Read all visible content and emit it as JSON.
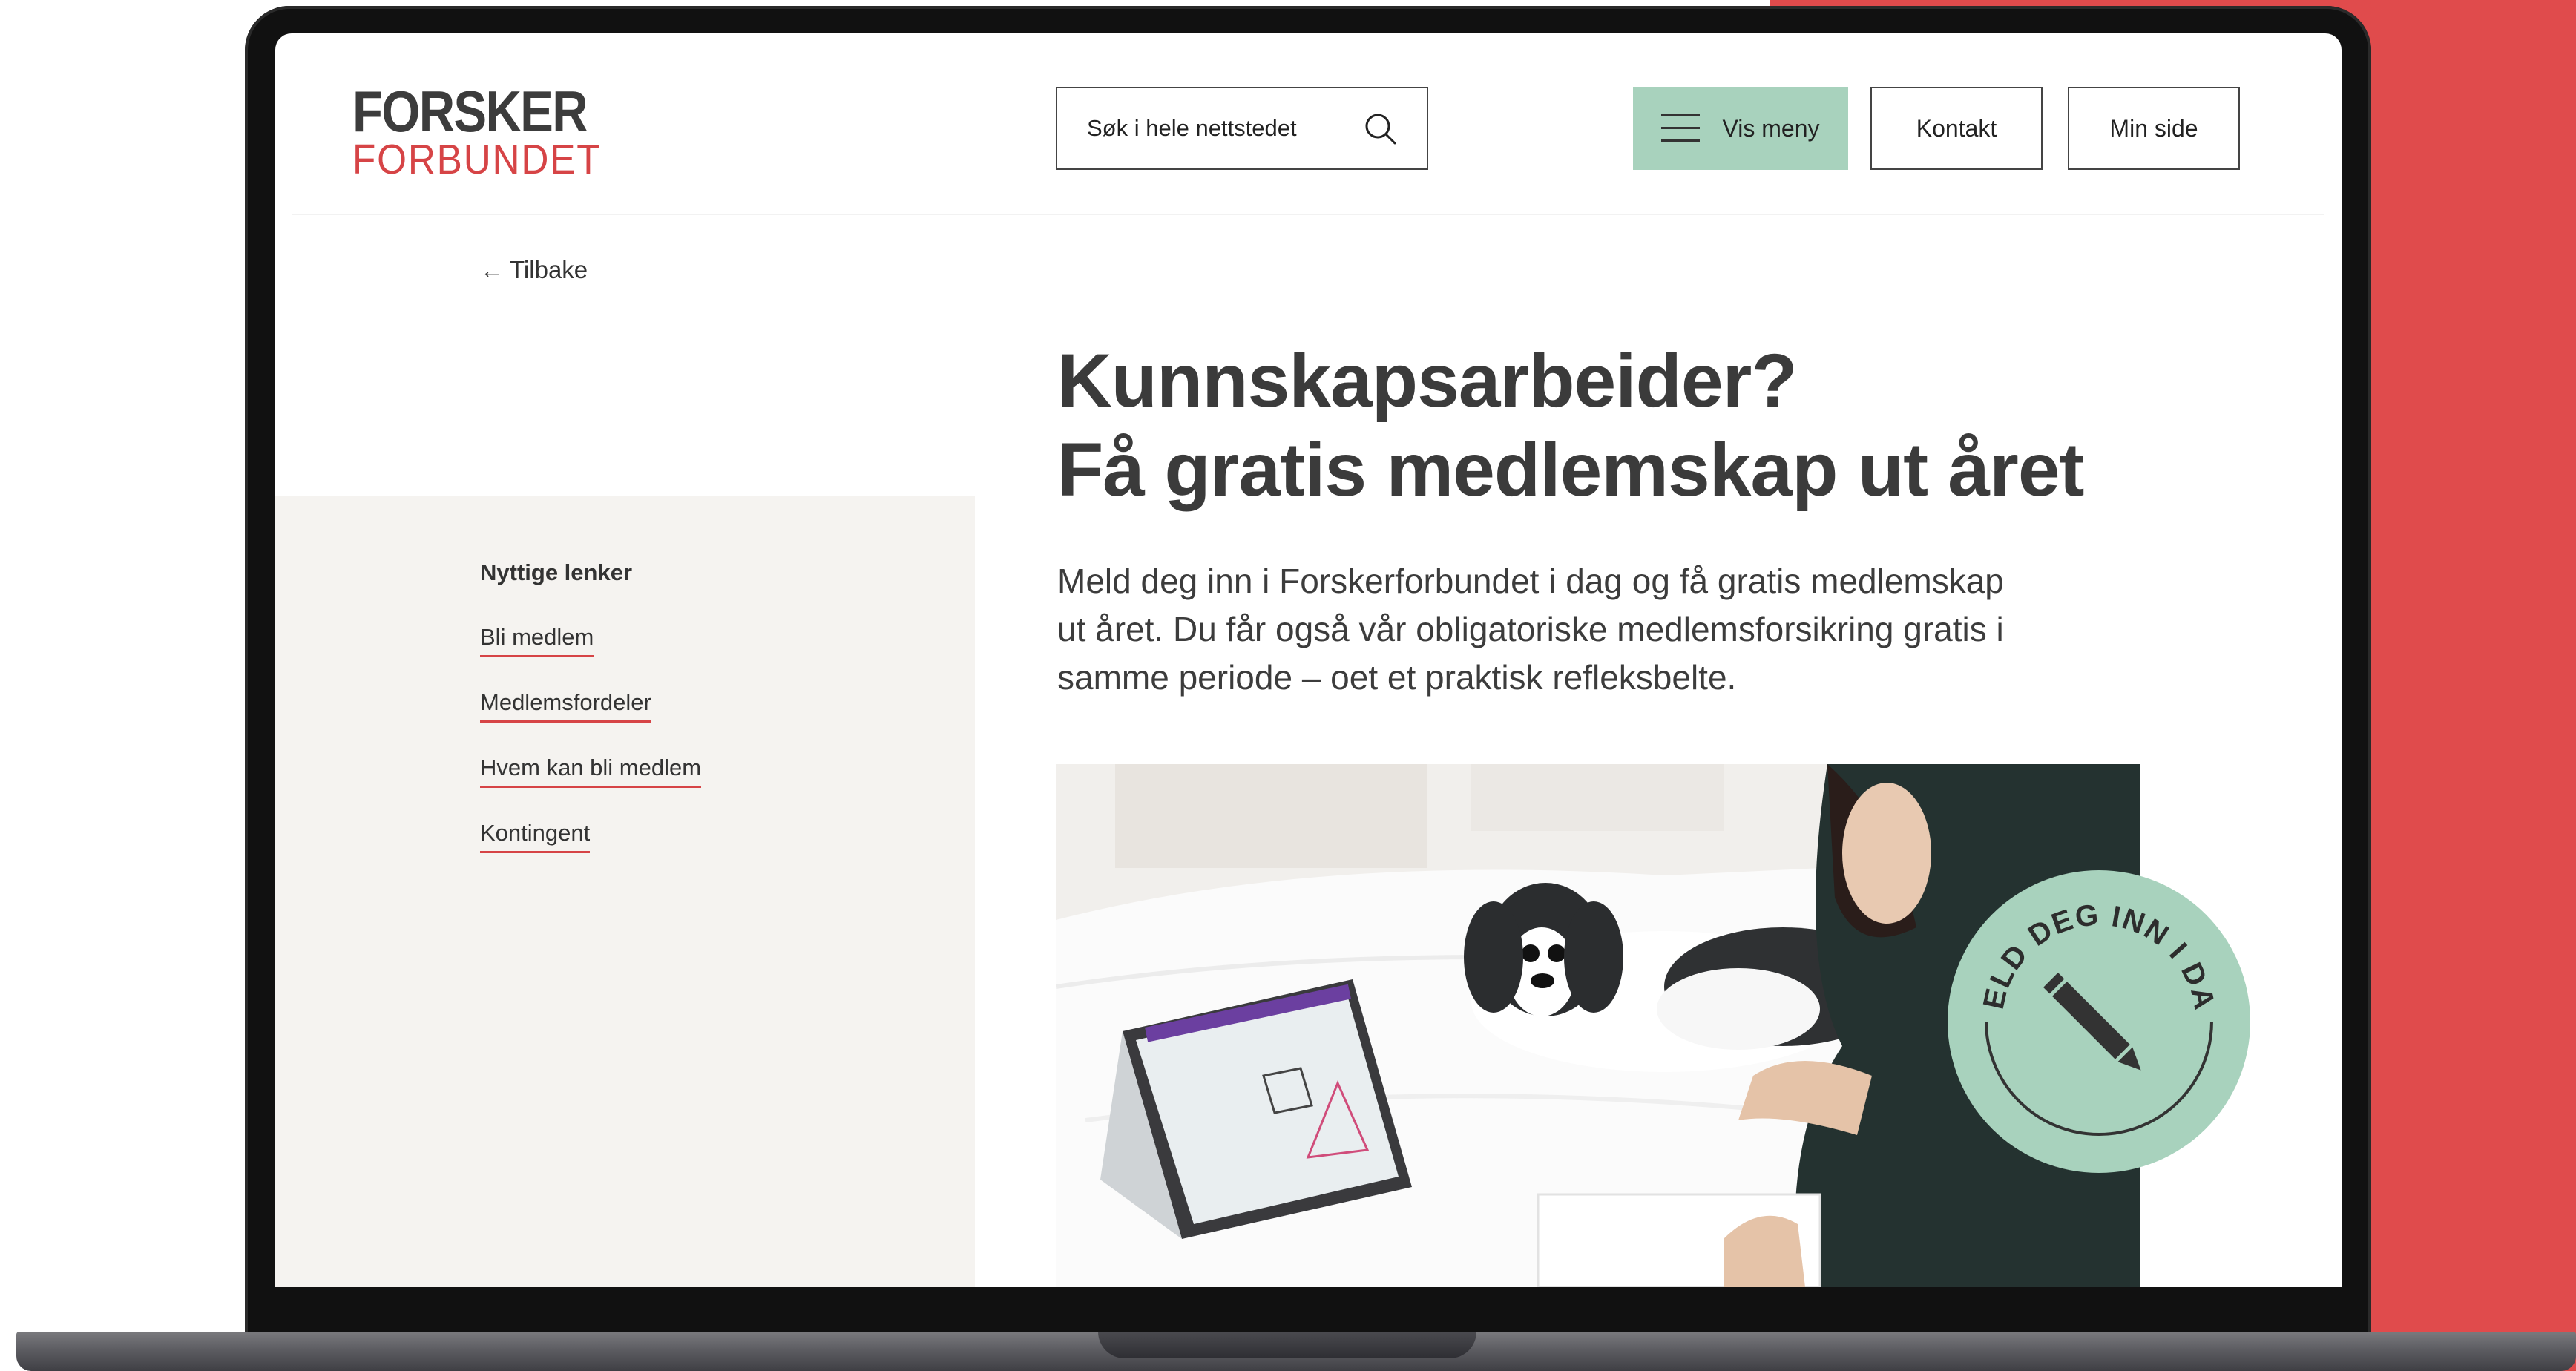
{
  "header": {
    "logo": {
      "line1": "FORSKER",
      "line2": "FORBUNDET"
    },
    "search": {
      "placeholder": "Søk i hele nettstedet",
      "icon": "search-icon"
    },
    "menu_button": {
      "label": "Vis meny",
      "icon": "hamburger-icon"
    },
    "contact_button": "Kontakt",
    "my_page_button": "Min side"
  },
  "back_link": "Tilbake",
  "sidebar": {
    "title": "Nyttige lenker",
    "links": [
      "Bli medlem",
      "Medlemsfordeler",
      "Hvem kan bli medlem",
      "Kontingent"
    ]
  },
  "main": {
    "headline_line1": "Kunnskapsarbeider?",
    "headline_line2": "Få gratis medlemskap ut året",
    "intro_lines": [
      "Meld deg inn i Forskerforbundet i dag og få gratis medlemskap",
      "ut året. Du får også vår obligatoriske medlemsforsikring gratis i",
      "samme periode – oet et praktisk refleksbelte."
    ]
  },
  "badge": {
    "text": "MELD DEG INN I DAG",
    "icon": "pencil-icon"
  },
  "colors": {
    "accent_red": "#d64446",
    "mint": "#a8d2bd",
    "background_red": "#e04b4c",
    "sidebar_bg": "#f5f3f0"
  }
}
